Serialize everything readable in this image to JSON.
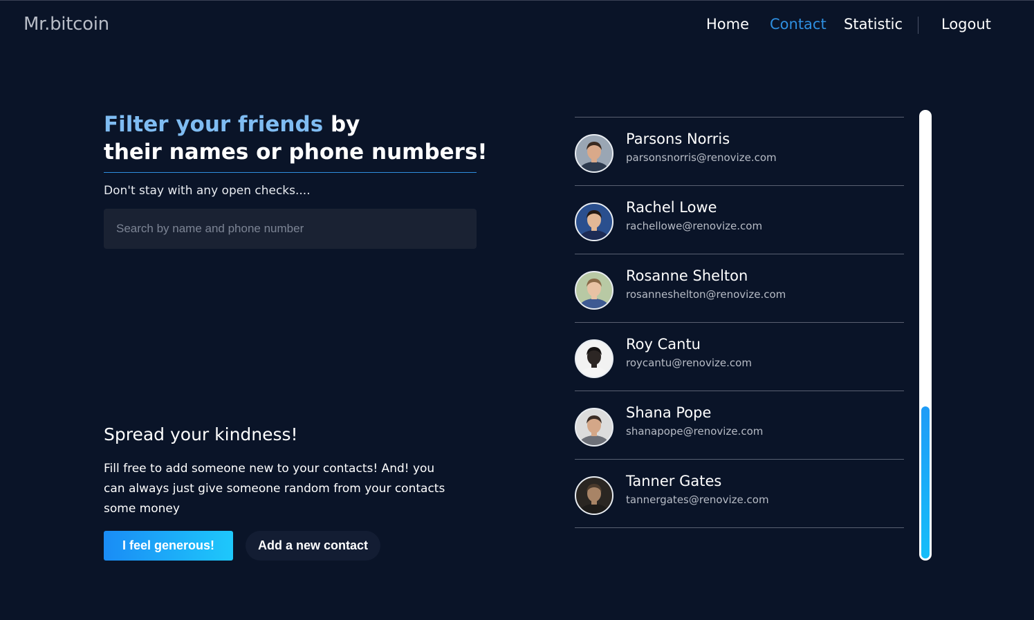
{
  "header": {
    "brand": "Mr.bitcoin",
    "nav": {
      "home": "Home",
      "contact": "Contact",
      "statistic": "Statistic",
      "logout": "Logout"
    },
    "active_color": "#2e8fe0"
  },
  "hero": {
    "title_accent": "Filter your friends",
    "title_rest_1": " by",
    "title_line2": "their names or phone numbers!",
    "subtitle": "Don't stay with any open checks....",
    "search_placeholder": "Search by name and phone number",
    "search_value": ""
  },
  "spread": {
    "title": "Spread your kindness!",
    "text": "Fill free to add someone new to your contacts! And! you can always just give someone random from your contacts some money",
    "generous_button": "I feel generous!",
    "add_button": "Add a new contact"
  },
  "contacts": [
    {
      "name": "Parsons Norris",
      "email": "parsonsnorris@renovize.com",
      "avatar_bg": "#9aa6b4",
      "skin": "#d9a98a",
      "hair": "#3a2a20",
      "shirt": "#2d3a4e"
    },
    {
      "name": "Rachel Lowe",
      "email": "rachellowe@renovize.com",
      "avatar_bg": "#2a4f8e",
      "skin": "#e2b896",
      "hair": "#241a14",
      "shirt": "#1d2b55"
    },
    {
      "name": "Rosanne Shelton",
      "email": "rosanneshelton@renovize.com",
      "avatar_bg": "#b8c9a4",
      "skin": "#e8c2a4",
      "hair": "#8a6a48",
      "shirt": "#3e5a92"
    },
    {
      "name": "Roy Cantu",
      "email": "roycantu@renovize.com",
      "avatar_bg": "#f2f2f2",
      "skin": "#2c2624",
      "hair": "#151212",
      "shirt": "#f5f5f5"
    },
    {
      "name": "Shana Pope",
      "email": "shanapope@renovize.com",
      "avatar_bg": "#dcdcdc",
      "skin": "#d4a788",
      "hair": "#3a2c24",
      "shirt": "#6d7078"
    },
    {
      "name": "Tanner Gates",
      "email": "tannergates@renovize.com",
      "avatar_bg": "#2a2622",
      "skin": "#a88466",
      "hair": "#4a3a2c",
      "shirt": "#1e1c1a"
    }
  ],
  "scrollbar": {
    "thumb_fraction": 0.34
  }
}
